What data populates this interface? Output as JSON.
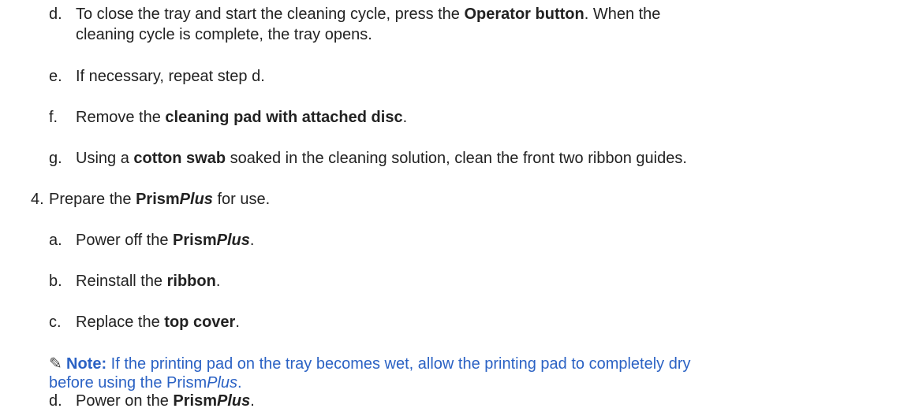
{
  "items": [
    {
      "marker": "d.",
      "pre": "To close the tray and start the cleaning cycle, press the ",
      "bold": "Operator button",
      "post": ". When the"
    },
    {
      "cont": "cleaning cycle is complete, the tray opens."
    },
    {
      "marker": "e.",
      "text": "If necessary, repeat step d."
    },
    {
      "marker": "f.",
      "pre": "Remove the ",
      "bold": "cleaning pad with attached disc",
      "post": "."
    },
    {
      "marker": "g.",
      "pre": "Using a ",
      "bold": "cotton swab",
      "post": " soaked in the cleaning solution, clean the front two ribbon guides."
    },
    {
      "marker": "4.",
      "pre": "Prepare the ",
      "bold": "Prism",
      "bolditalic": "Plus",
      "post": " for use."
    },
    {
      "marker": "a.",
      "pre": "Power off the ",
      "bold": "Prism",
      "bolditalic": "Plus",
      "post": "."
    },
    {
      "marker": "b.",
      "pre": "Reinstall the ",
      "bold": "ribbon",
      "post": "."
    },
    {
      "marker": "c.",
      "pre": "Replace the ",
      "bold": "top cover",
      "post": "."
    },
    {
      "marker": "d.",
      "pre": "Power on the ",
      "bold": "Prism",
      "bolditalic": "Plus",
      "post": "."
    }
  ],
  "note": {
    "icon": "pencil-icon",
    "label": "Note:",
    "line1": " If the printing pad on the tray becomes wet, allow the printing pad to completely dry",
    "line2_pre": "before using the Prism",
    "line2_italic": "Plus",
    "line2_post": "."
  }
}
